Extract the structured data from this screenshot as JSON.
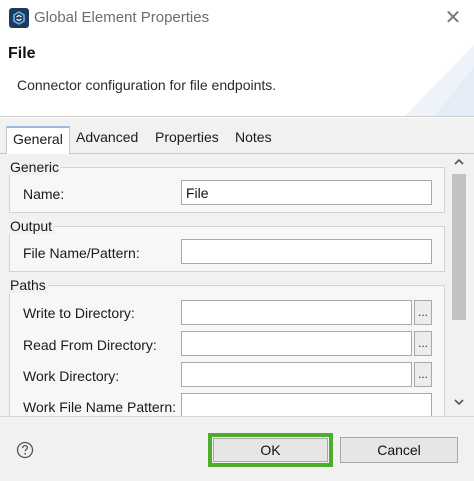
{
  "window": {
    "title": "Global Element Properties",
    "close_symbol": "✕",
    "app_icon": "mule-icon"
  },
  "header": {
    "title": "File",
    "description": "Connector configuration for file endpoints."
  },
  "tabs": [
    {
      "label": "General",
      "active": true
    },
    {
      "label": "Advanced",
      "active": false
    },
    {
      "label": "Properties",
      "active": false
    },
    {
      "label": "Notes",
      "active": false
    }
  ],
  "groups": {
    "generic": {
      "title": "Generic",
      "name_label": "Name:",
      "name_value": "File"
    },
    "output": {
      "title": "Output",
      "pattern_label": "File Name/Pattern:",
      "pattern_value": ""
    },
    "paths": {
      "title": "Paths",
      "write_label": "Write to Directory:",
      "read_label": "Read From Directory:",
      "work_label": "Work Directory:",
      "work_pattern_label": "Work File Name Pattern:",
      "browse_label": "..."
    }
  },
  "footer": {
    "help_icon": "help-icon",
    "ok_label": "OK",
    "cancel_label": "Cancel",
    "highlight_color": "#4cac2e"
  }
}
